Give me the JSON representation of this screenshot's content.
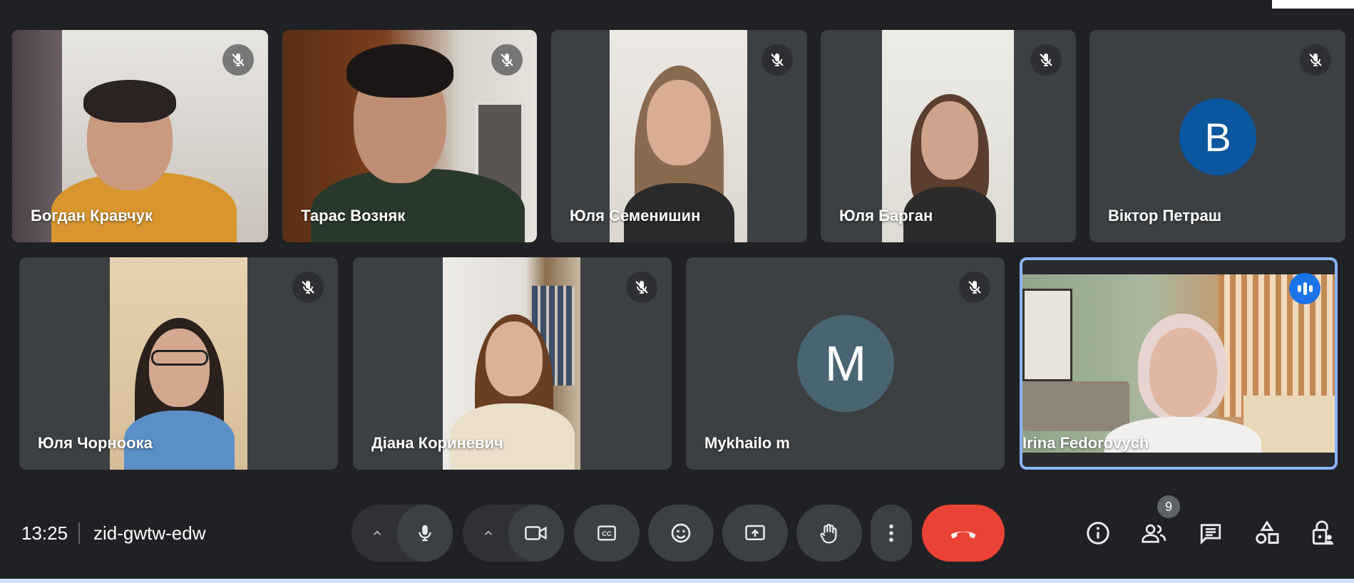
{
  "participants": [
    {
      "name": "Богдан Кравчук",
      "muted": true
    },
    {
      "name": "Тарас Возняк",
      "muted": true
    },
    {
      "name": "Юля Семенишин",
      "muted": true
    },
    {
      "name": "Юля Барган",
      "muted": true
    },
    {
      "name": "Віктор Петраш",
      "muted": true,
      "avatar_letter": "В",
      "avatar_color": "#0b57a0"
    },
    {
      "name": "Юля Чорноока",
      "muted": true
    },
    {
      "name": "Діана Кориневич",
      "muted": true
    },
    {
      "name": "Mykhailo m",
      "muted": true,
      "avatar_letter": "M",
      "avatar_color": "#4a6572"
    },
    {
      "name": "Irina Fedorovych",
      "muted": false,
      "speaking": true
    }
  ],
  "footer": {
    "time": "13:25",
    "meeting_code": "zid-gwtw-edw",
    "people_count": "9"
  },
  "controls": [
    "mic-options",
    "microphone",
    "camera-options",
    "camera",
    "captions",
    "reactions",
    "present-screen",
    "raise-hand",
    "more-options",
    "leave-call"
  ],
  "right_controls": [
    "meeting-info",
    "people",
    "chat",
    "activities",
    "host-controls"
  ],
  "colors": {
    "end_call": "#ea4335",
    "active_border": "#8ab4f8",
    "accent": "#1a73e8"
  }
}
